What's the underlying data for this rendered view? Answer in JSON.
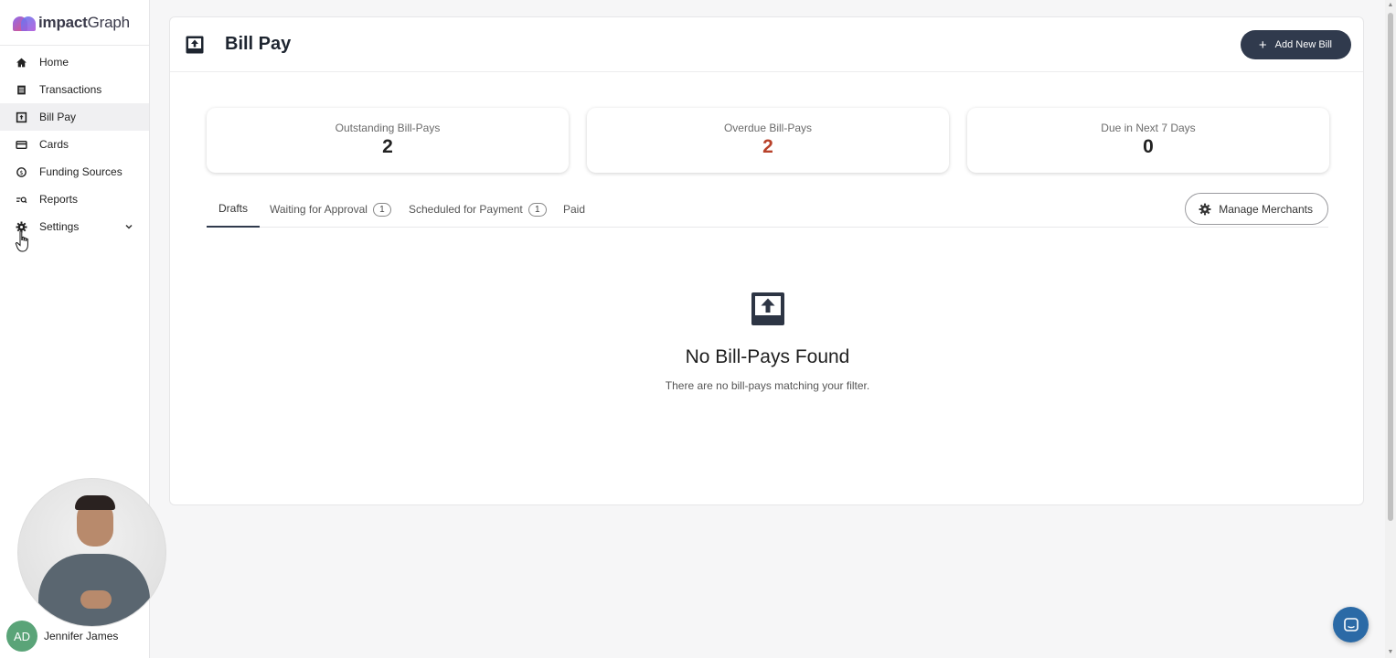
{
  "app": {
    "logo_bold": "impact",
    "logo_rest": "Graph"
  },
  "sidebar": {
    "items": [
      {
        "label": "Home",
        "icon": "home-icon"
      },
      {
        "label": "Transactions",
        "icon": "receipt-icon"
      },
      {
        "label": "Bill Pay",
        "icon": "bill-upload-icon",
        "active": true
      },
      {
        "label": "Cards",
        "icon": "credit-card-icon"
      },
      {
        "label": "Funding Sources",
        "icon": "funding-icon"
      },
      {
        "label": "Reports",
        "icon": "reports-search-icon"
      },
      {
        "label": "Settings",
        "icon": "gear-icon"
      }
    ],
    "user": {
      "initials": "AD",
      "name": "Jennifer James"
    }
  },
  "header": {
    "title": "Bill Pay",
    "add_button": "Add New Bill"
  },
  "stats": [
    {
      "label": "Outstanding Bill-Pays",
      "value": "2"
    },
    {
      "label": "Overdue Bill-Pays",
      "value": "2"
    },
    {
      "label": "Due in Next 7 Days",
      "value": "0"
    }
  ],
  "tabs": [
    {
      "label": "Drafts"
    },
    {
      "label": "Waiting for Approval",
      "count": "1"
    },
    {
      "label": "Scheduled for Payment",
      "count": "1"
    },
    {
      "label": "Paid"
    }
  ],
  "manage_button": "Manage Merchants",
  "empty_state": {
    "title": "No Bill-Pays Found",
    "subtitle": "There are no bill-pays matching your filter."
  },
  "colors": {
    "primary": "#303a4d",
    "overdue": "#b8412a",
    "chat": "#2b6aa6",
    "avatar": "#5aa478"
  }
}
